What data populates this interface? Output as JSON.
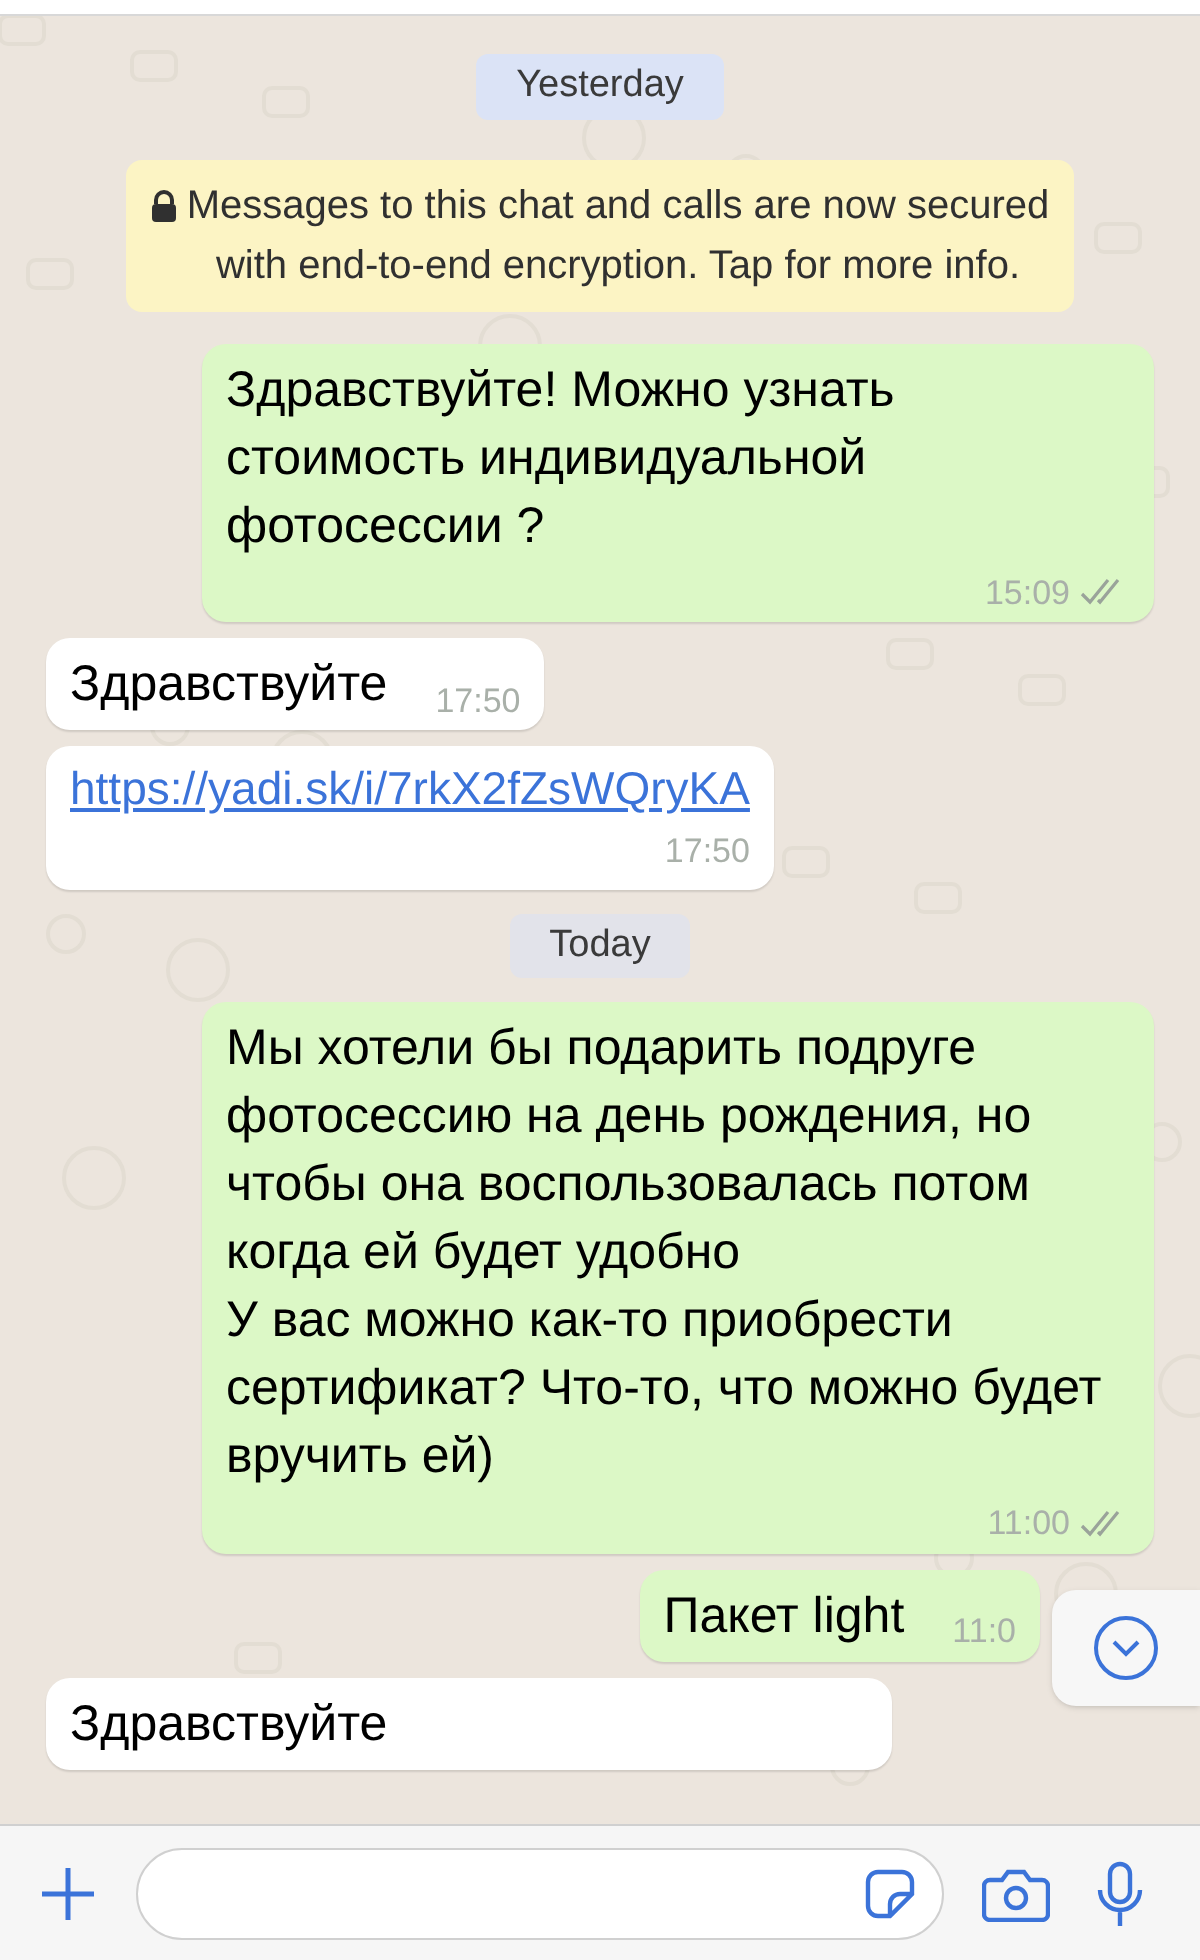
{
  "chat": [
    {
      "kind": "date",
      "text": "Yesterday",
      "color": "#dbe3f6"
    },
    {
      "kind": "notice",
      "text": "Messages to this chat and calls are now secured with end-to-end encryption. Tap for more info."
    },
    {
      "kind": "message",
      "outgoing": true,
      "text": "Здравствуйте! Можно узнать стоимость индивидуальной фотосессии ?",
      "time": "15:09",
      "read": false
    },
    {
      "kind": "message",
      "outgoing": false,
      "text": "Здравствуйте",
      "time": "17:50"
    },
    {
      "kind": "link",
      "outgoing": false,
      "text": "https://yadi.sk/i/7rkX2fZsWQryKA",
      "time": "17:50"
    },
    {
      "kind": "date",
      "text": "Today",
      "color": "#e2e3ea"
    },
    {
      "kind": "message",
      "outgoing": true,
      "text": "Мы хотели бы подарить подруге фотосессию на день рождения, но чтобы она воспользовалась потом когда ей будет удобно\nУ вас можно как-то приобрести сертификат? Что-то, что можно будет вручить ей)",
      "time": "11:00",
      "read": false
    },
    {
      "kind": "message",
      "outgoing": true,
      "text": "Пакет light",
      "time": "11:0",
      "scroll_button": true
    },
    {
      "kind": "message",
      "outgoing": false,
      "text": "Здравствуйте"
    }
  ]
}
